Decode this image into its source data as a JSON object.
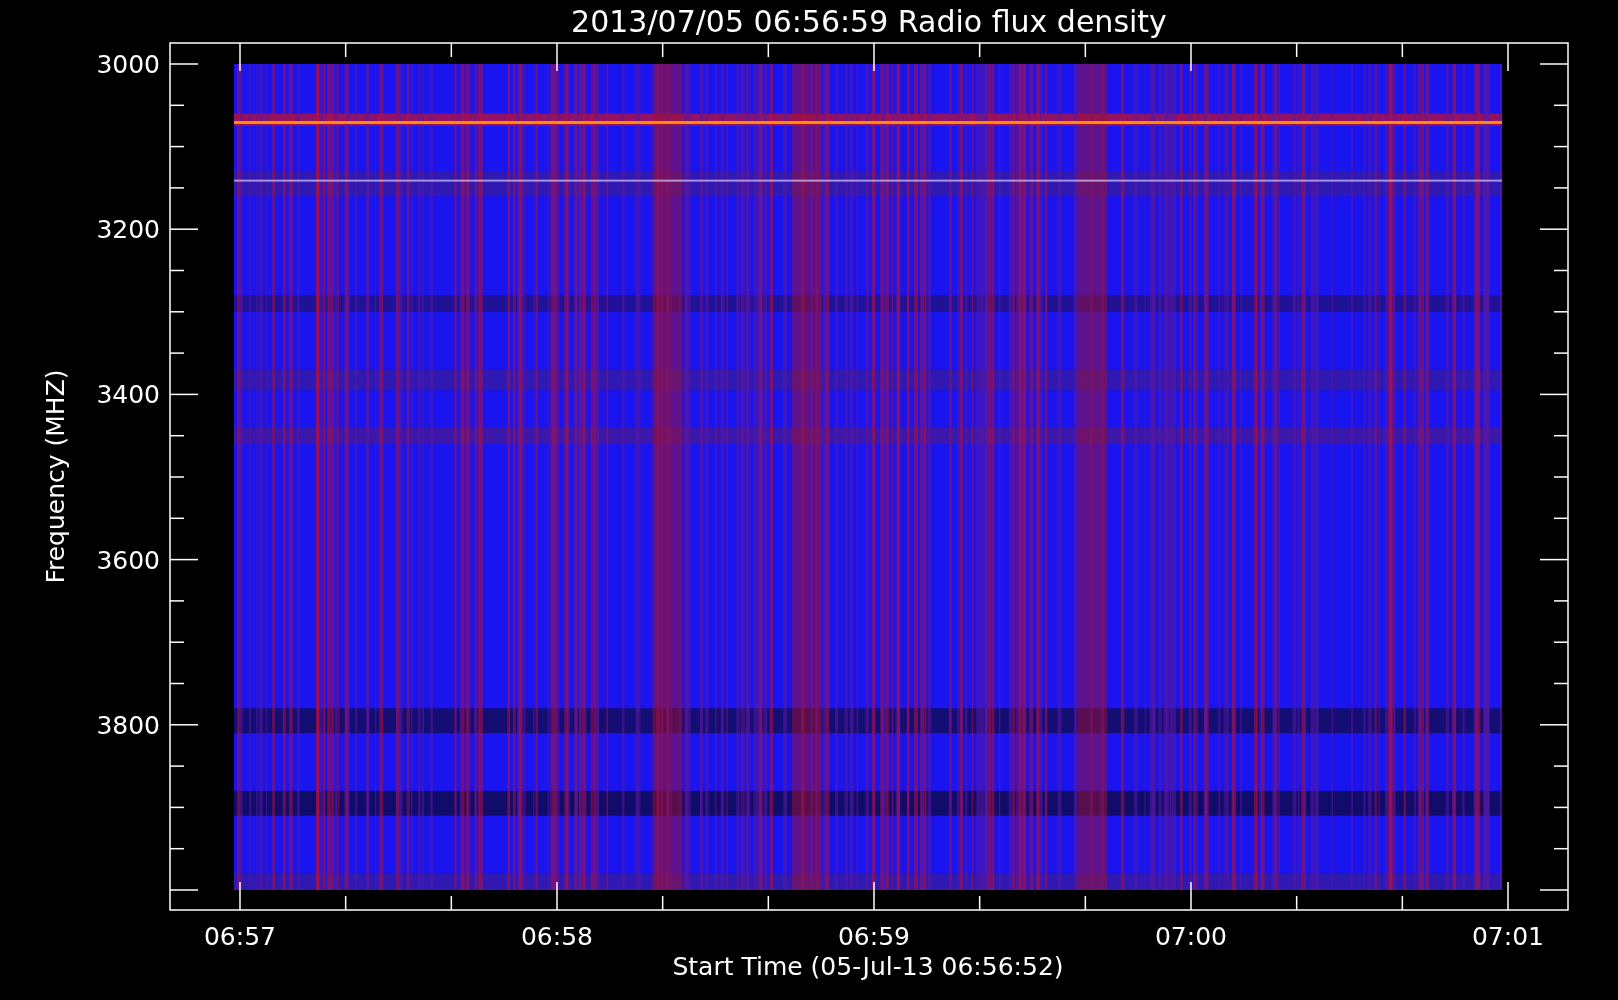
{
  "title": "2013/07/05 06:56:59 Radio flux density",
  "y_axis": {
    "label": "Frequency (MHZ)",
    "tick_labels": [
      "3000",
      "3200",
      "3400",
      "3600",
      "3800"
    ]
  },
  "x_axis": {
    "label": "Start Time (05-Jul-13 06:56:52)",
    "tick_labels": [
      "06:57",
      "06:58",
      "06:59",
      "07:00",
      "07:01"
    ]
  }
}
